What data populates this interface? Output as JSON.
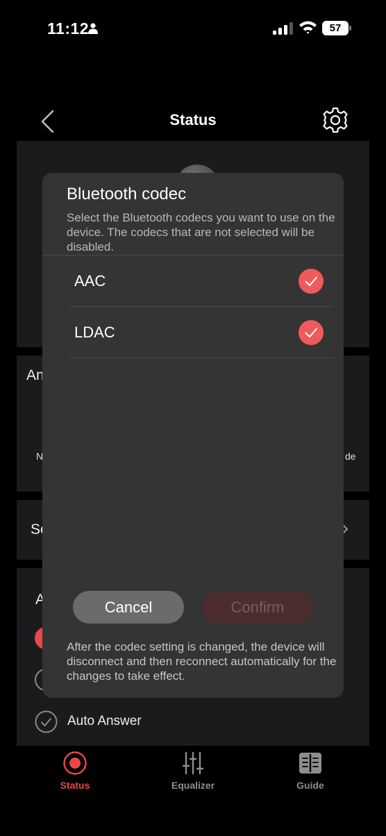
{
  "status_bar": {
    "time": "11:12",
    "battery": "57"
  },
  "header": {
    "title": "Status"
  },
  "background": {
    "card2_title_fragment": "An",
    "card2_left_fragment": "N",
    "card2_right_fragment": "de",
    "card3_fragment": "So",
    "card4_fragment": "A",
    "auto_answer_label": "Auto Answer"
  },
  "dialog": {
    "title": "Bluetooth codec",
    "description": "Select the Bluetooth codecs you want to use on the device. The codecs that are not selected will be disabled.",
    "codecs": [
      {
        "label": "AAC",
        "checked": true
      },
      {
        "label": "LDAC",
        "checked": true
      }
    ],
    "cancel_label": "Cancel",
    "confirm_label": "Confirm",
    "footer_note": "After the codec setting is changed, the device will disconnect and then reconnect automatically for the changes to take effect."
  },
  "tabs": [
    {
      "label": "Status",
      "icon": "status-record-icon",
      "active": true
    },
    {
      "label": "Equalizer",
      "icon": "equalizer-sliders-icon",
      "active": false
    },
    {
      "label": "Guide",
      "icon": "guide-book-icon",
      "active": false
    }
  ],
  "colors": {
    "accent": "#f15a5a",
    "active_tab": "#e8484a",
    "inactive_tab": "#8e8e8e"
  }
}
